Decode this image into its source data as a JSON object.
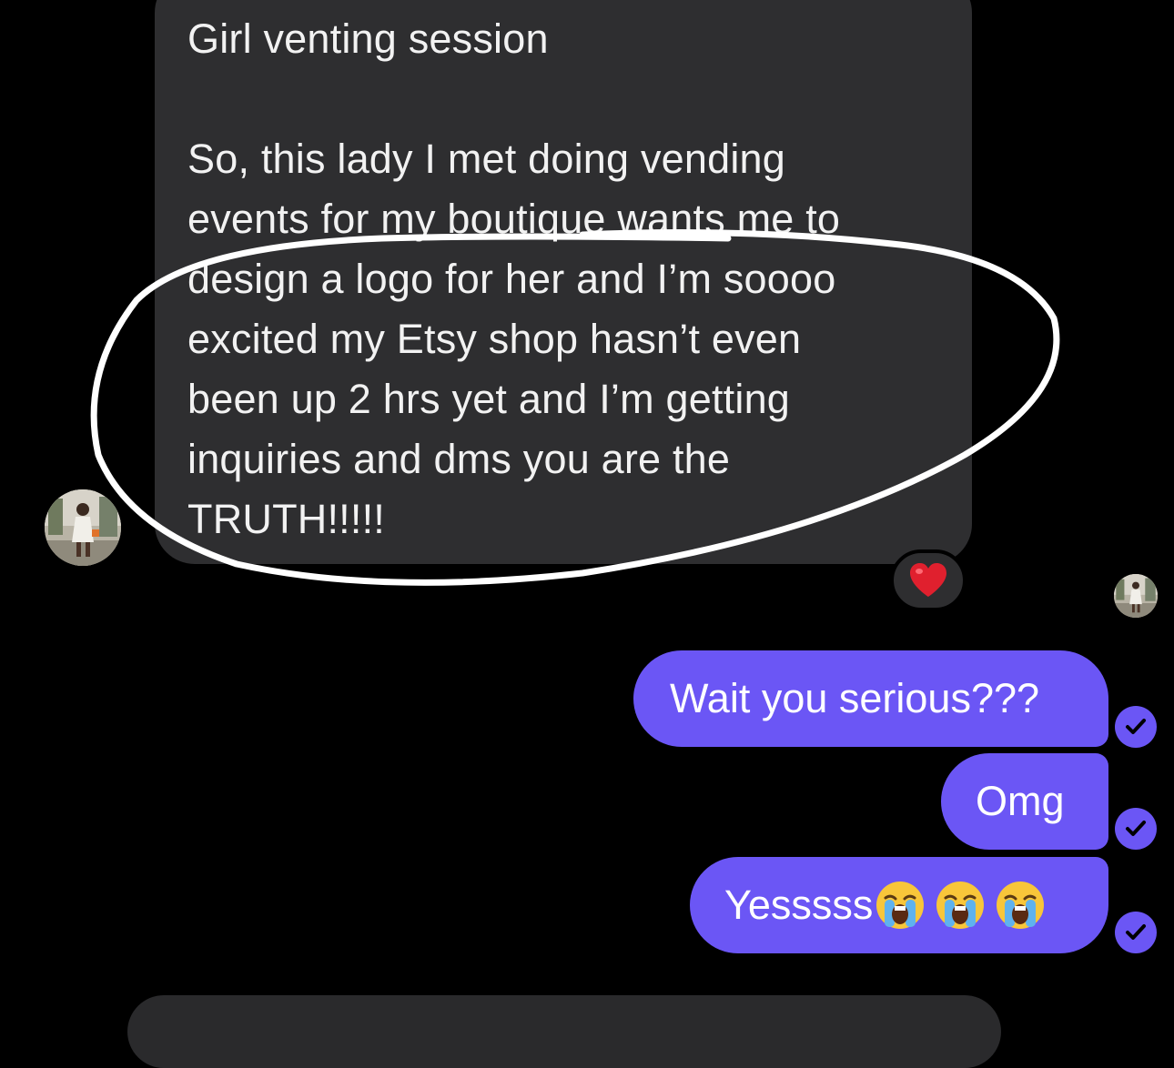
{
  "conversation": {
    "incoming": {
      "title": "Girl venting session",
      "lines": [
        "So, this lady I met doing vending",
        "events for my boutique wants me to",
        "design a logo for her and I’m soooo",
        "excited my Etsy shop hasn’t  even",
        "been up 2 hrs yet and I’m getting",
        "inquiries and dms you are the",
        "TRUTH!!!!!"
      ],
      "reaction": "heart-icon"
    },
    "outgoing": [
      {
        "text": "Wait you serious???",
        "status": "read"
      },
      {
        "text": "Omg",
        "status": "read"
      },
      {
        "text": "Yesssss",
        "emoji": [
          "loudly-crying-face-icon",
          "loudly-crying-face-icon",
          "loudly-crying-face-icon"
        ],
        "status": "read"
      }
    ]
  },
  "colors": {
    "background": "#000000",
    "incoming_bubble": "#2e2e30",
    "outgoing_bubble": "#6b56f5",
    "annotation_stroke": "#ffffff",
    "reaction_heart": "#e0202e"
  }
}
